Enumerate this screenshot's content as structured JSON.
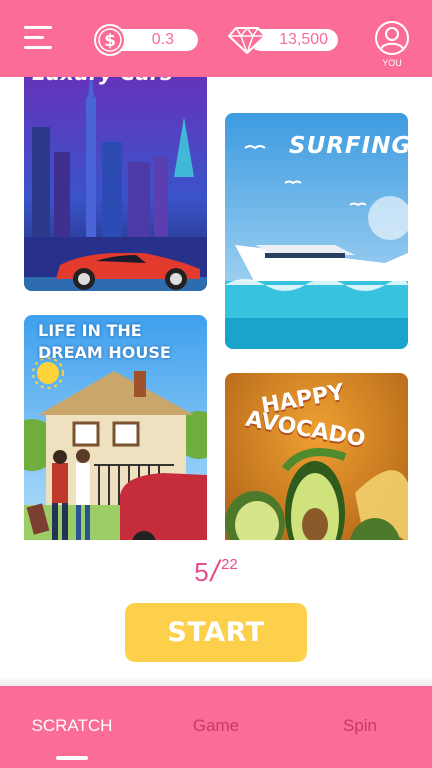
{
  "header": {
    "coins": "0.3",
    "gems": "13,500",
    "profile_label": "YOU"
  },
  "cards": [
    {
      "title": "Luxury Cars"
    },
    {
      "title": "SURFING"
    },
    {
      "title_line1": "LIFE IN THE",
      "title_line2": "DREAM HOUSE"
    },
    {
      "title_line1": "HAPPY",
      "title_line2": "AVOCADO"
    }
  ],
  "pager": {
    "current": "5",
    "total": "22"
  },
  "start_label": "START",
  "nav": {
    "tabs": [
      {
        "label": "SCRATCH"
      },
      {
        "label": "Game"
      },
      {
        "label": "Spin"
      }
    ]
  },
  "colors": {
    "brand_pink": "#fb6c97",
    "start_yellow": "#fdd04b",
    "pager_pink": "#e74c8c"
  }
}
